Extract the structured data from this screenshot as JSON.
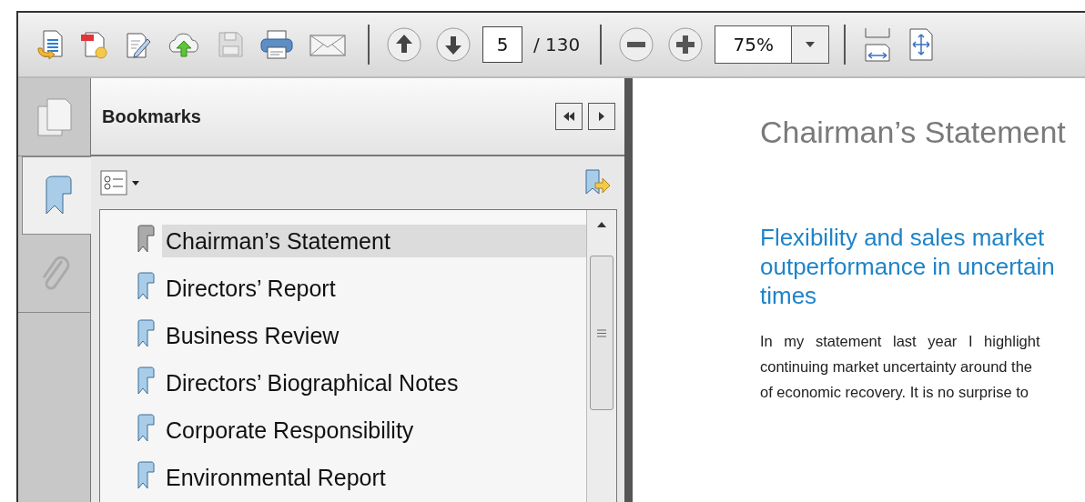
{
  "toolbar": {
    "page": "5",
    "page_total": "/ 130",
    "zoom": "75%"
  },
  "side_tabs": [
    {
      "kind": "pages",
      "selected": false
    },
    {
      "kind": "bookmarks",
      "selected": true
    },
    {
      "kind": "attachments",
      "selected": false
    }
  ],
  "bookmarks": {
    "title": "Bookmarks",
    "items": [
      {
        "label": "Chairman’s Statement",
        "selected": true
      },
      {
        "label": "Directors’ Report",
        "selected": false
      },
      {
        "label": "Business Review",
        "selected": false
      },
      {
        "label": "Directors’ Biographical Notes",
        "selected": false
      },
      {
        "label": "Corporate Responsibility",
        "selected": false
      },
      {
        "label": "Environmental Report",
        "selected": false
      }
    ]
  },
  "document": {
    "title": "Chairman’s Statement",
    "heading": [
      "Flexibility and sales market",
      "outperformance in uncertain",
      "times"
    ],
    "body": [
      "In my statement last year I highlight",
      "continuing market uncertainty around the",
      "of economic recovery.  It is no surprise to"
    ]
  }
}
